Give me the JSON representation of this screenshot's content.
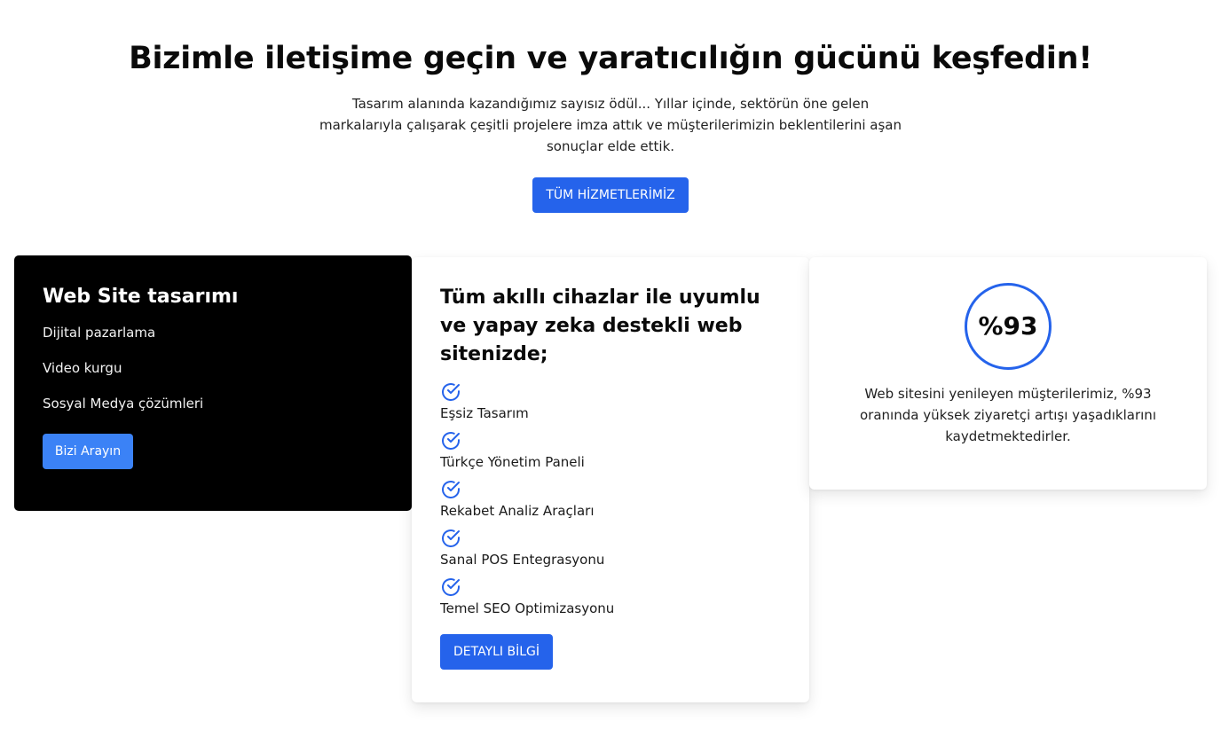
{
  "hero": {
    "title": "Bizimle iletişime geçin ve yaratıcılığın gücünü keşfedin!",
    "description": "Tasarım alanında kazandığımız sayısız ödül... Yıllar içinde, sektörün öne gelen markalarıyla çalışarak çeşitli projelere imza attık ve müşterilerimizin beklentilerini aşan sonuçlar elde ettik.",
    "button_label": "TÜM HİZMETLERİMİZ"
  },
  "services_card": {
    "title": "Web Site tasarımı",
    "items": [
      "Dijital pazarlama",
      "Video kurgu",
      "Sosyal Medya çözümleri"
    ],
    "button_label": "Bizi Arayın"
  },
  "features_card": {
    "title": "Tüm akıllı cihazlar ile uyumlu ve yapay zeka destekli web sitenizde;",
    "items": [
      {
        "icon": "check-circle-icon",
        "label": "Eşsiz Tasarım"
      },
      {
        "icon": "check-circle-icon",
        "label": "Türkçe Yönetim Paneli"
      },
      {
        "icon": "check-circle-icon",
        "label": "Rekabet Analiz Araçları"
      },
      {
        "icon": "check-circle-icon",
        "label": "Sanal POS Entegrasyonu"
      },
      {
        "icon": "check-circle-icon",
        "label": "Temel SEO Optimizasyonu"
      }
    ],
    "button_label": "DETAYLI BİLGİ"
  },
  "stat_card": {
    "value": "%93",
    "description": "Web sitesini yenileyen müşterilerimiz, %93 oranında yüksek ziyaretçi artışı yaşadıklarını kaydetmektedirler."
  },
  "colors": {
    "accent": "#2563eb",
    "accent_light": "#3b82f6",
    "dark_card": "#000000"
  }
}
